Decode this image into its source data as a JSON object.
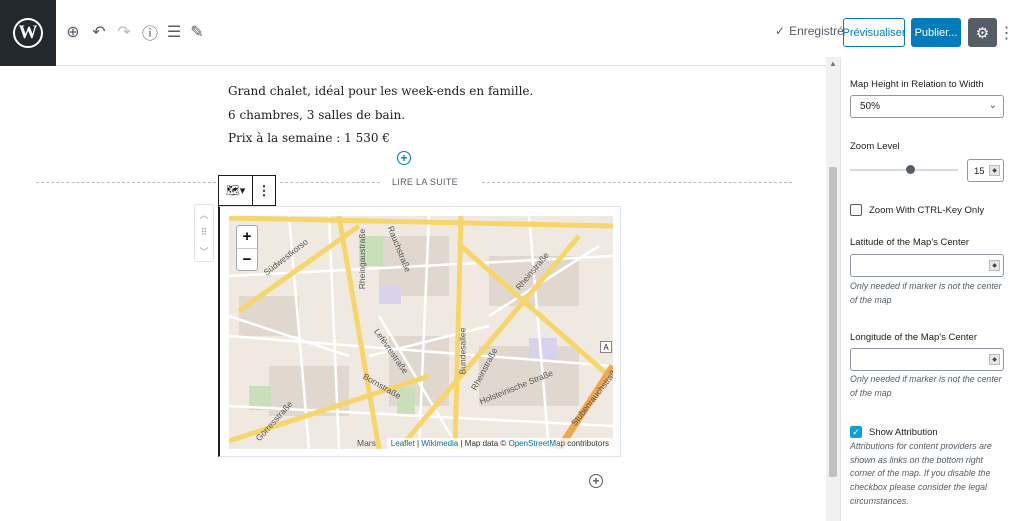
{
  "toolbar": {
    "logo_glyph": "W",
    "saved_label": "Enregistré",
    "preview_label": "Prévisualiser",
    "publish_label": "Publier..."
  },
  "content": {
    "paragraphs": [
      "Grand chalet, idéal pour les week-ends en famille.",
      "6 chambres, 3 salles de bain.",
      "Prix à la semaine : 1 530 €"
    ],
    "more_label": "LIRE LA SUITE"
  },
  "map": {
    "zoom_in": "+",
    "zoom_out": "−",
    "attribution_leaflet": "Leaflet",
    "attribution_sep1": " | ",
    "attribution_wikimedia": "Wikimedia",
    "attribution_mid": " | Map data © ",
    "attribution_osm": "OpenStreetMap",
    "attribution_end": " contributors",
    "street_labels": {
      "s1": "Südwestkorso",
      "s2": "Rheingaustraße",
      "s3": "Rauchstraße",
      "s4": "Bundesallee",
      "s5": "Rheinstraße",
      "s6": "Lefèvrestraße",
      "s7": "Bornstraße",
      "s8": "Holsteinische Straße",
      "s9": "Rheinstraße",
      "s10": "Görresstraße",
      "s11": "Mars",
      "s12": "Stubenrauchstraße"
    },
    "road_badge": "A"
  },
  "sidebar": {
    "map_height_label": "Map Height in Relation to Width",
    "map_height_value": "50%",
    "zoom_level_label": "Zoom Level",
    "zoom_level_value": "15",
    "zoom_level_fraction": 0.56,
    "ctrl_key_label": "Zoom With CTRL-Key Only",
    "ctrl_key_checked": false,
    "latitude_label": "Latitude of the Map's Center",
    "latitude_help": "Only needed if marker is not the center of the map",
    "longitude_label": "Longitude of the Map's Center",
    "longitude_help": "Only needed if marker is not the center of the map",
    "attribution_label": "Show Attribution",
    "attribution_checked": true,
    "attribution_help": "Attributions for content providers are shown as links on the bottom right corner of the map. If you disable the checkbox please consider the legal circumstances."
  },
  "colors": {
    "accent": "#007cba",
    "admin_dark": "#23282d",
    "map_road_major": "#f6d66b",
    "map_road_arterial": "#f0a64a",
    "map_background": "#efe9e1"
  }
}
